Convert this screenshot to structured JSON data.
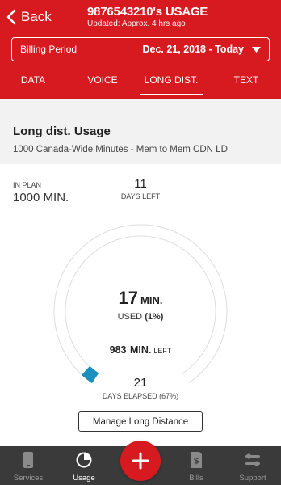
{
  "header": {
    "back_label": "Back",
    "title": "9876543210's USAGE",
    "subtitle": "Updated: Approx. 4 hrs ago",
    "background_color": "#d71920"
  },
  "billing": {
    "label": "Billing Period",
    "value": "Dec. 21, 2018 - Today"
  },
  "tabs": [
    {
      "label": "DATA",
      "active": false
    },
    {
      "label": "VOICE",
      "active": false
    },
    {
      "label": "LONG DIST.",
      "active": true
    },
    {
      "label": "TEXT",
      "active": false
    }
  ],
  "usage": {
    "title": "Long dist. Usage",
    "description": "1000 Canada-Wide Minutes - Mem to Mem CDN LD"
  },
  "gauge": {
    "in_plan_label": "IN PLAN",
    "in_plan_value": "1000 MIN.",
    "days_left_value": "11",
    "days_left_label": "DAYS LEFT",
    "used_value": "17",
    "used_unit": "MIN.",
    "used_label": "USED",
    "used_percent": "(1%)",
    "used_fraction": 0.017,
    "left_value": "983",
    "left_unit_bold": "MIN.",
    "left_unit": "LEFT",
    "days_elapsed_value": "21",
    "days_elapsed_label": "DAYS ELAPSED (67%)",
    "track_color": "#dddddd",
    "fill_color": "#1a8fc0"
  },
  "manage_button": "Manage Long Distance",
  "bottom_nav": [
    {
      "label": "Services",
      "icon": "phone-icon",
      "active": false
    },
    {
      "label": "Usage",
      "icon": "pie-chart-icon",
      "active": true
    },
    {
      "label": "",
      "icon": "plus-icon",
      "active": false
    },
    {
      "label": "Bills",
      "icon": "dollar-document-icon",
      "active": false
    },
    {
      "label": "Support",
      "icon": "wrench-icon",
      "active": false
    }
  ]
}
